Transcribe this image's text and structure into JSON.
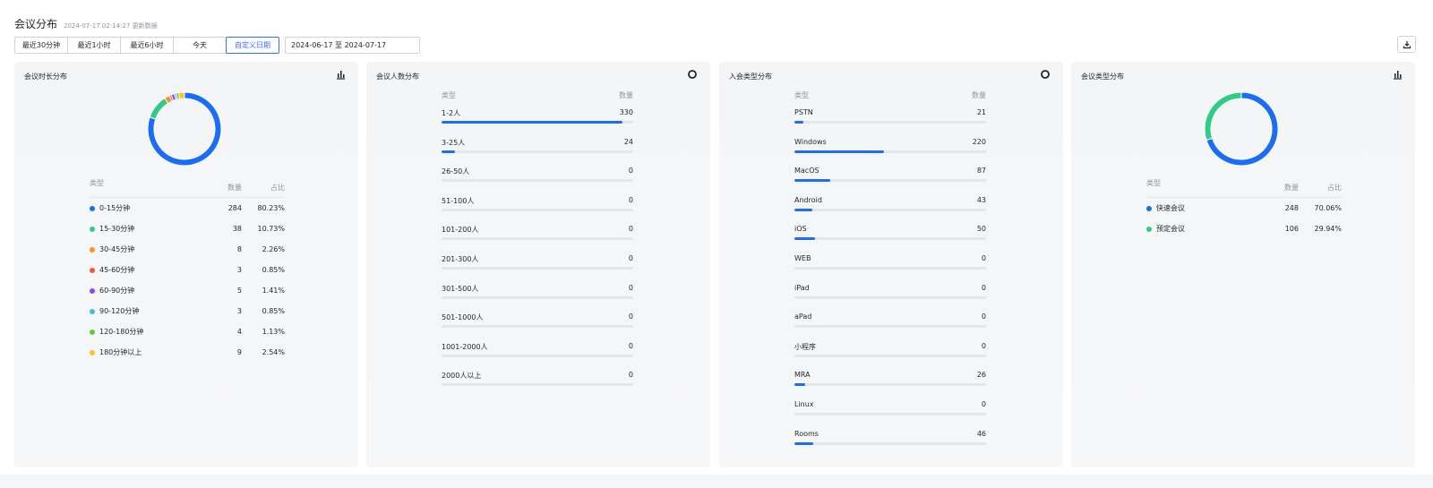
{
  "header": {
    "title": "会议分布",
    "updated": "2024-07-17 02:14:27 更新数据"
  },
  "toolbar": {
    "ranges": [
      "最近30分钟",
      "最近1小时",
      "最近6小时",
      "今天",
      "自定义日期"
    ],
    "active_range": "自定义日期",
    "date_range": "2024-06-17 至 2024-07-17"
  },
  "colors": {
    "accent": "#3370ff",
    "bar": "#1a6ef5",
    "track": "#e4e6e9"
  },
  "duration_panel": {
    "title": "会议时长分布",
    "col_type": "类型",
    "col_count": "数量",
    "col_pct": "占比",
    "rows": [
      {
        "label": "0-15分钟",
        "count": "284",
        "pct": "80.23%",
        "value": 284,
        "color": "#1a6ef5"
      },
      {
        "label": "15-30分钟",
        "count": "38",
        "pct": "10.73%",
        "value": 38,
        "color": "#2ecc86"
      },
      {
        "label": "30-45分钟",
        "count": "8",
        "pct": "2.26%",
        "value": 8,
        "color": "#ff8f1f"
      },
      {
        "label": "45-60分钟",
        "count": "3",
        "pct": "0.85%",
        "value": 3,
        "color": "#f2553d"
      },
      {
        "label": "60-90分钟",
        "count": "5",
        "pct": "1.41%",
        "value": 5,
        "color": "#8e49f2"
      },
      {
        "label": "90-120分钟",
        "count": "3",
        "pct": "0.85%",
        "value": 3,
        "color": "#3fc1d8"
      },
      {
        "label": "120-180分钟",
        "count": "4",
        "pct": "1.13%",
        "value": 4,
        "color": "#5ccf2b"
      },
      {
        "label": "180分钟以上",
        "count": "9",
        "pct": "2.54%",
        "value": 9,
        "color": "#ffc22e"
      }
    ]
  },
  "participants_panel": {
    "title": "会议人数分布",
    "col_type": "类型",
    "col_count": "数量",
    "max": 350,
    "rows": [
      {
        "label": "1-2人",
        "count": "330",
        "value": 330
      },
      {
        "label": "3-25人",
        "count": "24",
        "value": 24
      },
      {
        "label": "26-50人",
        "count": "0",
        "value": 0
      },
      {
        "label": "51-100人",
        "count": "0",
        "value": 0
      },
      {
        "label": "101-200人",
        "count": "0",
        "value": 0
      },
      {
        "label": "201-300人",
        "count": "0",
        "value": 0
      },
      {
        "label": "301-500人",
        "count": "0",
        "value": 0
      },
      {
        "label": "501-1000人",
        "count": "0",
        "value": 0
      },
      {
        "label": "1001-2000人",
        "count": "0",
        "value": 0
      },
      {
        "label": "2000人以上",
        "count": "0",
        "value": 0
      }
    ]
  },
  "join_type_panel": {
    "title": "入会类型分布",
    "col_type": "类型",
    "col_count": "数量",
    "max": 470,
    "rows": [
      {
        "label": "PSTN",
        "count": "21",
        "value": 21
      },
      {
        "label": "Windows",
        "count": "220",
        "value": 220
      },
      {
        "label": "MacOS",
        "count": "87",
        "value": 87
      },
      {
        "label": "Android",
        "count": "43",
        "value": 43
      },
      {
        "label": "iOS",
        "count": "50",
        "value": 50
      },
      {
        "label": "WEB",
        "count": "0",
        "value": 0
      },
      {
        "label": "iPad",
        "count": "0",
        "value": 0
      },
      {
        "label": "aPad",
        "count": "0",
        "value": 0
      },
      {
        "label": "小程序",
        "count": "0",
        "value": 0
      },
      {
        "label": "MRA",
        "count": "26",
        "value": 26
      },
      {
        "label": "Linux",
        "count": "0",
        "value": 0
      },
      {
        "label": "Rooms",
        "count": "46",
        "value": 46
      }
    ]
  },
  "meeting_type_panel": {
    "title": "会议类型分布",
    "col_type": "类型",
    "col_count": "数量",
    "col_pct": "占比",
    "rows": [
      {
        "label": "快速会议",
        "count": "248",
        "pct": "70.06%",
        "value": 248,
        "color": "#1a6ef5"
      },
      {
        "label": "预定会议",
        "count": "106",
        "pct": "29.94%",
        "value": 106,
        "color": "#2ecc86"
      }
    ]
  },
  "chart_data": [
    {
      "type": "pie",
      "categories": [
        "0-15分钟",
        "15-30分钟",
        "30-45分钟",
        "45-60分钟",
        "60-90分钟",
        "90-120分钟",
        "120-180分钟",
        "180分钟以上"
      ],
      "values": [
        284,
        38,
        8,
        3,
        5,
        3,
        4,
        9
      ],
      "title": "会议时长分布"
    },
    {
      "type": "bar",
      "categories": [
        "1-2人",
        "3-25人",
        "26-50人",
        "51-100人",
        "101-200人",
        "201-300人",
        "301-500人",
        "501-1000人",
        "1001-2000人",
        "2000人以上"
      ],
      "values": [
        330,
        24,
        0,
        0,
        0,
        0,
        0,
        0,
        0,
        0
      ],
      "title": "会议人数分布"
    },
    {
      "type": "bar",
      "categories": [
        "PSTN",
        "Windows",
        "MacOS",
        "Android",
        "iOS",
        "WEB",
        "iPad",
        "aPad",
        "小程序",
        "MRA",
        "Linux",
        "Rooms"
      ],
      "values": [
        21,
        220,
        87,
        43,
        50,
        0,
        0,
        0,
        0,
        26,
        0,
        46
      ],
      "title": "入会类型分布"
    },
    {
      "type": "pie",
      "categories": [
        "快速会议",
        "预定会议"
      ],
      "values": [
        248,
        106
      ],
      "title": "会议类型分布"
    }
  ]
}
